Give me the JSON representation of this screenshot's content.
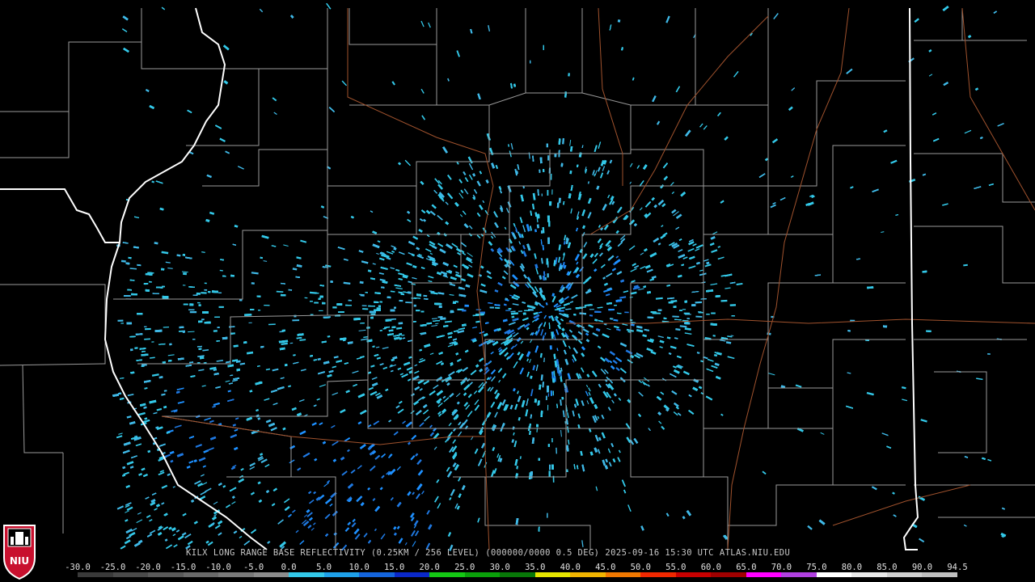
{
  "caption": {
    "station": "KILX",
    "product": "LONG RANGE BASE REFLECTIVITY (0.25KM / 256 LEVEL)",
    "code": "(000000/0000 0.5 DEG)",
    "datetime": "2025-09-16 15:30 UTC",
    "source": "ATLAS.NIU.EDU"
  },
  "logo": {
    "text": "NIU",
    "name": "niu-shield-logo"
  },
  "colors": {
    "background": "#000000",
    "county_lines": "#9a9a9a",
    "state_lines": "#ffffff",
    "roads": "#a0522d"
  },
  "scale": {
    "labels": [
      "-30.0",
      "-25.0",
      "-20.0",
      "-15.0",
      "-10.0",
      "-5.0",
      "0.0",
      "5.0",
      "10.0",
      "15.0",
      "20.0",
      "25.0",
      "30.0",
      "35.0",
      "40.0",
      "45.0",
      "50.0",
      "55.0",
      "60.0",
      "65.0",
      "70.0",
      "75.0",
      "80.0",
      "85.0",
      "90.0",
      "94.5"
    ],
    "colors": [
      "#3a3a3a",
      "#4a4a4a",
      "#5a5a5a",
      "#6a6a6a",
      "#7a7a7a",
      "#8c8c8c",
      "#33c8e8",
      "#1ea0e8",
      "#1464dc",
      "#0a28c8",
      "#14c814",
      "#0aa00a",
      "#087808",
      "#e6e600",
      "#f0b400",
      "#f07800",
      "#f02800",
      "#c80000",
      "#a00000",
      "#ff00ff",
      "#b040e0",
      "#ffffff",
      "#e8e8e8",
      "#d0d0d0",
      "#c0c0c0"
    ]
  }
}
